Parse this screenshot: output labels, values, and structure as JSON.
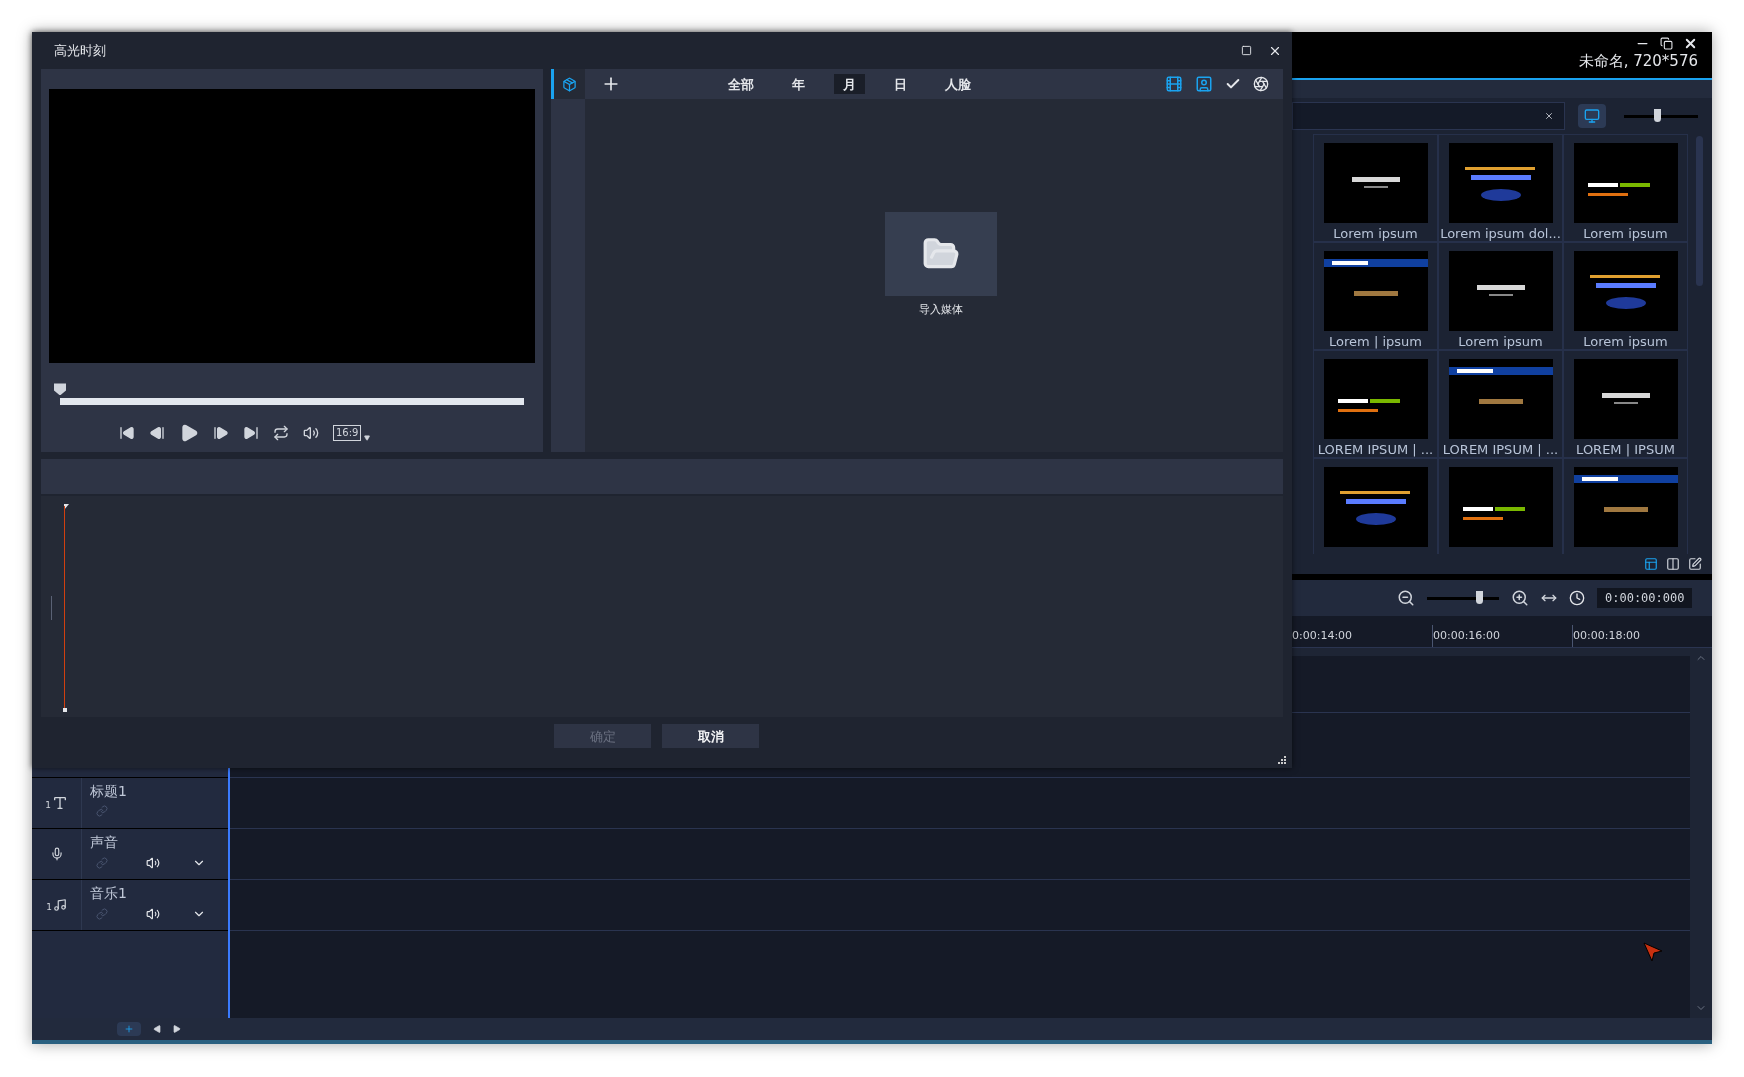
{
  "main_window": {
    "project": "未命名, 720*576"
  },
  "library": {
    "size_slider": {
      "level": 0.45
    },
    "thumbnails": [
      {
        "kind": "captioned",
        "caption": "Lorem ipsum"
      },
      {
        "kind": "captioned",
        "caption": "Lorem ipsum dol..."
      },
      {
        "kind": "captioned",
        "caption": "Lorem ipsum"
      },
      {
        "kind": "captioned",
        "caption": "Lorem | ipsum"
      },
      {
        "kind": "captioned",
        "caption": "Lorem ipsum"
      },
      {
        "kind": "captioned",
        "caption": "Lorem ipsum"
      },
      {
        "kind": "captioned",
        "caption": "LOREM IPSUM | ..."
      },
      {
        "kind": "captioned",
        "caption": "LOREM IPSUM | ..."
      },
      {
        "kind": "captioned",
        "caption": "LOREM | IPSUM"
      },
      {
        "kind": "picture"
      },
      {
        "kind": "picture"
      },
      {
        "kind": "picture"
      }
    ]
  },
  "timeline": {
    "zoom": {
      "level": 0.72
    },
    "timecode": "0:00:00:000",
    "ruler": [
      "0:00:14:00",
      "00:00:16:00",
      "00:00:18:00"
    ],
    "tracks": [
      {
        "kind": "title",
        "badge": "1",
        "name": "标题1"
      },
      {
        "kind": "voice",
        "name": "声音"
      },
      {
        "kind": "music",
        "badge": "1",
        "name": "音乐1"
      }
    ]
  },
  "dialog": {
    "title": "高光时刻",
    "scrubber": {
      "level": 0
    },
    "aspect_ratio": "16:9",
    "filter_tabs": [
      {
        "label": "全部",
        "selected": false
      },
      {
        "label": "年",
        "selected": false
      },
      {
        "label": "月",
        "selected": true
      },
      {
        "label": "日",
        "selected": false
      },
      {
        "label": "人脸",
        "selected": false
      }
    ],
    "import_label": "导入媒体",
    "buttons": [
      {
        "label": "确定",
        "disabled": true
      },
      {
        "label": "取消",
        "disabled": false
      }
    ]
  }
}
